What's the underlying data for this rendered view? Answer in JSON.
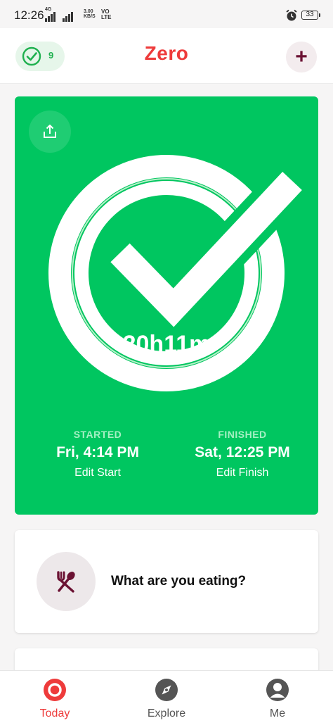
{
  "status_bar": {
    "time": "12:26",
    "network_type": "4G",
    "speed_value": "3.00",
    "speed_unit": "KB/S",
    "volte_top": "VO",
    "volte_bottom": "LTE",
    "battery": "33"
  },
  "header": {
    "title": "Zero",
    "streak_count": "9",
    "add_label": "+"
  },
  "fast_card": {
    "duration": "20h11m",
    "progress_fraction": 1.0,
    "started_label": "STARTED",
    "started_value": "Fri, 4:14 PM",
    "edit_start": "Edit Start",
    "finished_label": "FINISHED",
    "finished_value": "Sat, 12:25 PM",
    "edit_finish": "Edit Finish"
  },
  "eat_card": {
    "prompt": "What are you eating?"
  },
  "bottom_nav": {
    "items": [
      {
        "label": "Today",
        "icon": "today-icon",
        "active": true
      },
      {
        "label": "Explore",
        "icon": "compass-icon",
        "active": false
      },
      {
        "label": "Me",
        "icon": "profile-icon",
        "active": false
      }
    ]
  },
  "colors": {
    "brand_red": "#ee3b3b",
    "card_green": "#00c660",
    "accent_maroon": "#6b1233"
  }
}
